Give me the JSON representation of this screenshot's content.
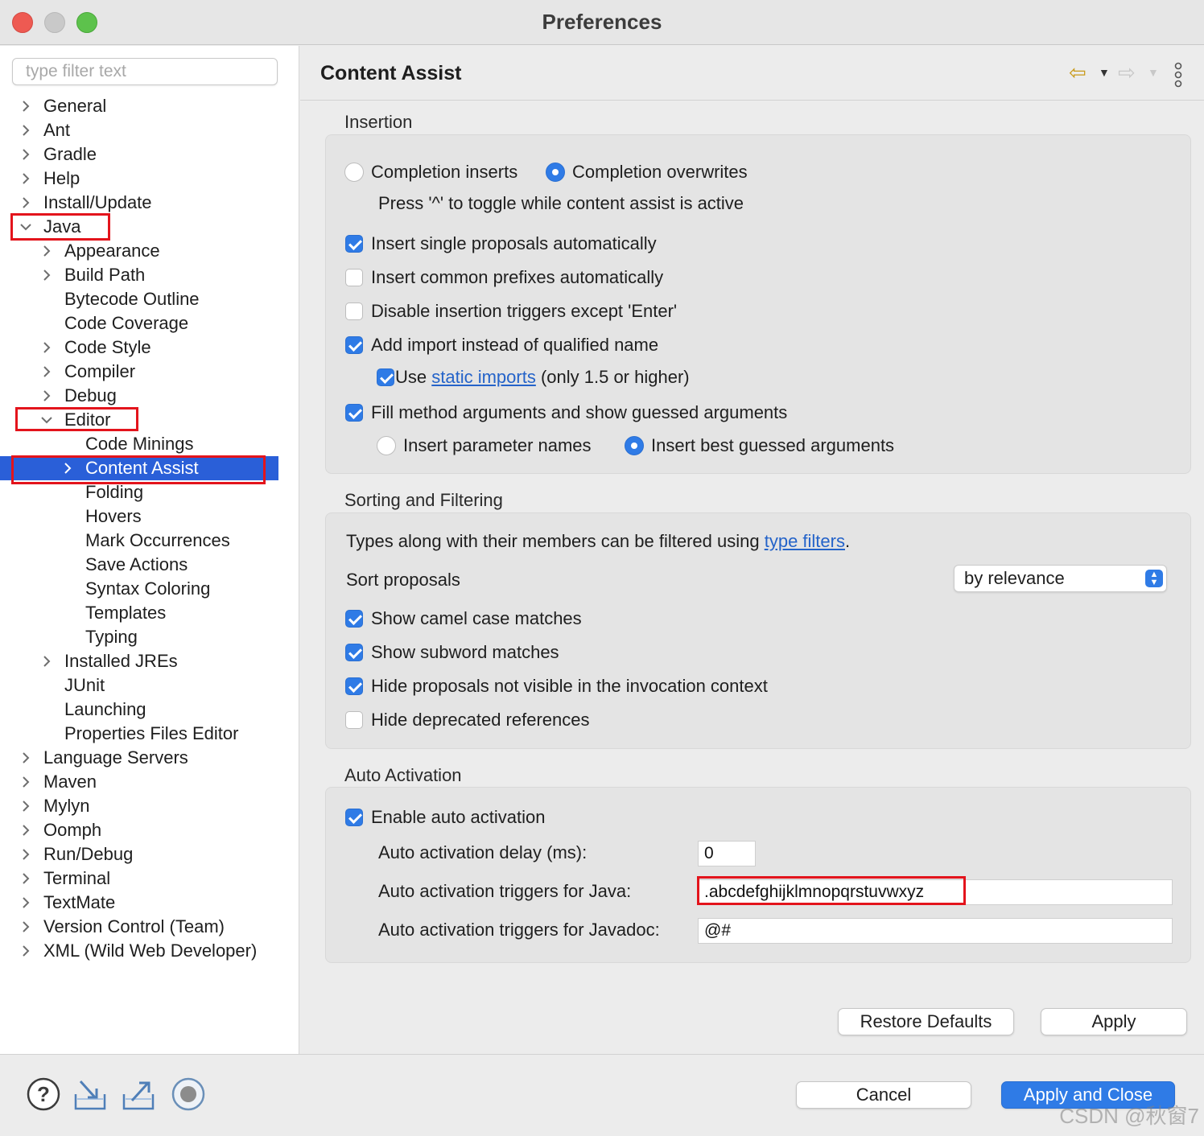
{
  "window": {
    "title": "Preferences"
  },
  "sidebar": {
    "filter_placeholder": "type filter text",
    "items": [
      {
        "label": "General",
        "expanded": false
      },
      {
        "label": "Ant",
        "expanded": false
      },
      {
        "label": "Gradle",
        "expanded": false
      },
      {
        "label": "Help",
        "expanded": false
      },
      {
        "label": "Install/Update",
        "expanded": false
      },
      {
        "label": "Java",
        "expanded": true
      },
      {
        "label": "Appearance",
        "expanded": false
      },
      {
        "label": "Build Path",
        "expanded": false
      },
      {
        "label": "Bytecode Outline"
      },
      {
        "label": "Code Coverage"
      },
      {
        "label": "Code Style",
        "expanded": false
      },
      {
        "label": "Compiler",
        "expanded": false
      },
      {
        "label": "Debug",
        "expanded": false
      },
      {
        "label": "Editor",
        "expanded": true
      },
      {
        "label": "Code Minings"
      },
      {
        "label": "Content Assist",
        "expanded": false,
        "selected": true
      },
      {
        "label": "Folding"
      },
      {
        "label": "Hovers"
      },
      {
        "label": "Mark Occurrences"
      },
      {
        "label": "Save Actions"
      },
      {
        "label": "Syntax Coloring"
      },
      {
        "label": "Templates"
      },
      {
        "label": "Typing"
      },
      {
        "label": "Installed JREs",
        "expanded": false
      },
      {
        "label": "JUnit"
      },
      {
        "label": "Launching"
      },
      {
        "label": "Properties Files Editor"
      },
      {
        "label": "Language Servers",
        "expanded": false
      },
      {
        "label": "Maven",
        "expanded": false
      },
      {
        "label": "Mylyn",
        "expanded": false
      },
      {
        "label": "Oomph",
        "expanded": false
      },
      {
        "label": "Run/Debug",
        "expanded": false
      },
      {
        "label": "Terminal",
        "expanded": false
      },
      {
        "label": "TextMate",
        "expanded": false
      },
      {
        "label": "Version Control (Team)",
        "expanded": false
      },
      {
        "label": "XML (Wild Web Developer)",
        "expanded": false
      }
    ]
  },
  "page": {
    "title": "Content Assist",
    "nav": {
      "back_icon": "back-arrow-icon",
      "forward_icon": "forward-arrow-icon",
      "menu_icon": "more-vertical-icon"
    }
  },
  "insertion": {
    "title": "Insertion",
    "completion_inserts": {
      "label": "Completion inserts",
      "selected": false
    },
    "completion_overwrites": {
      "label": "Completion overwrites",
      "selected": true
    },
    "toggle_hint": "Press '^' to toggle while content assist is active",
    "insert_single": {
      "label": "Insert single proposals automatically",
      "checked": true
    },
    "insert_common": {
      "label": "Insert common prefixes automatically",
      "checked": false
    },
    "disable_triggers": {
      "label": "Disable insertion triggers except 'Enter'",
      "checked": false
    },
    "add_import": {
      "label": "Add import instead of qualified name",
      "checked": true
    },
    "use_static": {
      "prefix": "Use ",
      "link": "static imports",
      "suffix": " (only 1.5 or higher)",
      "checked": true
    },
    "fill_method": {
      "label": "Fill method arguments and show guessed arguments",
      "checked": true
    },
    "insert_param_names": {
      "label": "Insert parameter names",
      "selected": false
    },
    "insert_best_guessed": {
      "label": "Insert best guessed arguments",
      "selected": true
    }
  },
  "sorting": {
    "title": "Sorting and Filtering",
    "types_text_prefix": "Types along with their members can be filtered using ",
    "types_link": "type filters",
    "types_text_suffix": ".",
    "sort_label": "Sort proposals",
    "sort_value": "by relevance",
    "camel": {
      "label": "Show camel case matches",
      "checked": true
    },
    "subword": {
      "label": "Show subword matches",
      "checked": true
    },
    "hide_invisible": {
      "label": "Hide proposals not visible in the invocation context",
      "checked": true
    },
    "hide_deprecated": {
      "label": "Hide deprecated references",
      "checked": false
    }
  },
  "auto_activation": {
    "title": "Auto Activation",
    "enable": {
      "label": "Enable auto activation",
      "checked": true
    },
    "delay_label": "Auto activation delay (ms):",
    "delay_value": "0",
    "java_label": "Auto activation triggers for Java:",
    "java_value": ".abcdefghijklmnopqrstuvwxyz",
    "javadoc_label": "Auto activation triggers for Javadoc:",
    "javadoc_value": "@#"
  },
  "buttons": {
    "restore_defaults": "Restore Defaults",
    "apply": "Apply",
    "cancel": "Cancel",
    "apply_and_close": "Apply and Close"
  },
  "bottom_icons": [
    "help-icon",
    "import-icon",
    "export-icon",
    "record-icon"
  ],
  "watermark": "CSDN @秋窗7",
  "colors": {
    "accent": "#2f7be6",
    "selection": "#2a5fd8",
    "highlight_box": "#e3141c",
    "link": "#2463c9"
  }
}
